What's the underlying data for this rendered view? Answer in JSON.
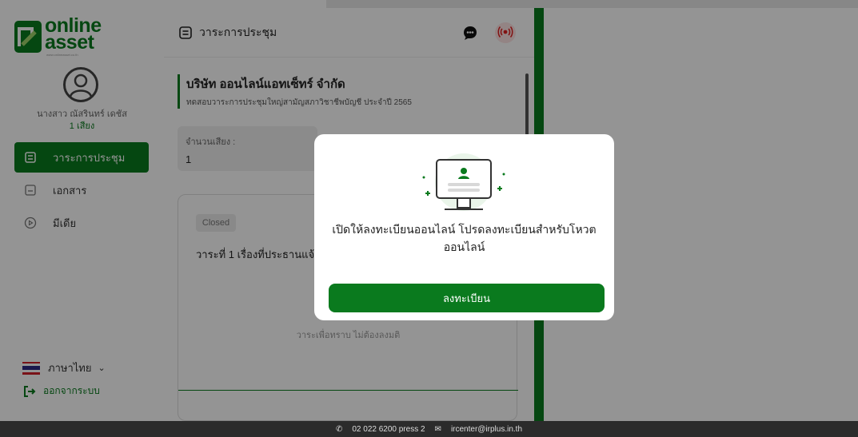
{
  "logo": {
    "line1": "online",
    "line2": "asset",
    "sub": "www.onlineasset.co.th"
  },
  "user": {
    "name": "นางสาว ณัสรินทร์ เดชัส",
    "votes": "1 เสียง"
  },
  "sidebar": {
    "items": [
      {
        "label": "วาระการประชุม",
        "icon": "agenda-icon",
        "active": true
      },
      {
        "label": "เอกสาร",
        "icon": "document-icon",
        "active": false
      },
      {
        "label": "มีเดีย",
        "icon": "media-play-icon",
        "active": false
      }
    ],
    "language": "ภาษาไทย",
    "logout": "ออกจากระบบ"
  },
  "main": {
    "header_title": "วาระการประชุม",
    "company_name": "บริษัท ออนไลน์แอทเซ็ทร์ จำกัด",
    "company_sub": "ทดสอบวาระการประชุมใหญ่สามัญสภาวิชาชีพบัญชี ประจำปี 2565",
    "votes_label": "จำนวนเสียง :",
    "votes_value": "1",
    "agenda": {
      "status": "Closed",
      "title": "วาระที่ 1 เรื่องที่ประธานแจ้ง",
      "note": "วาระเพื่อทราบ ไม่ต้องลงมติ"
    }
  },
  "modal": {
    "message": "เปิดให้ลงทะเบียนออนไลน์ โปรดลงทะเบียนสำหรับโหวตออนไลน์",
    "button": "ลงทะเบียน"
  },
  "footer": {
    "phone": "02 022 6200 press 2",
    "email": "ircenter@irplus.in.th"
  },
  "colors": {
    "brand_green": "#0a7a1e",
    "live_red": "#e02020",
    "footer_bg": "#2b2b2b"
  }
}
